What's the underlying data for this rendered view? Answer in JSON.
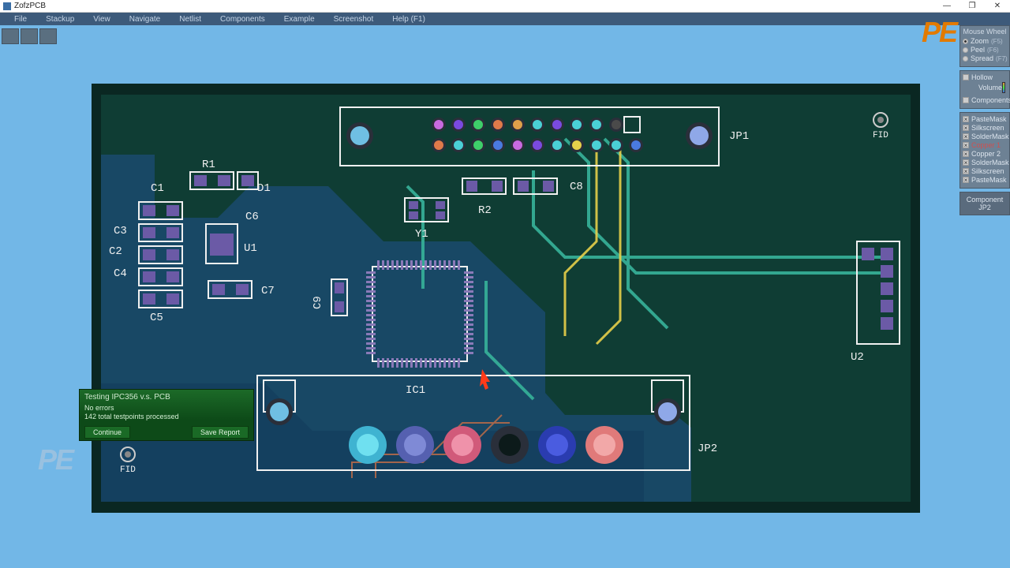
{
  "app": {
    "title": "ZofzPCB"
  },
  "window_controls": {
    "min": "—",
    "max": "❐",
    "close": "✕"
  },
  "menu": {
    "items": [
      "File",
      "Stackup",
      "View",
      "Navigate",
      "Netlist",
      "Components",
      "Example",
      "Screenshot",
      "Help (F1)"
    ]
  },
  "watermark": {
    "top": "PE",
    "bottom": "PE"
  },
  "side": {
    "wheel_title": "Mouse Wheel",
    "wheel_opts": [
      {
        "label": "Zoom",
        "kb": "(F5)",
        "selected": true
      },
      {
        "label": "Peel",
        "kb": "(F6)",
        "selected": false
      },
      {
        "label": "Spread",
        "kb": "(F7)",
        "selected": false
      }
    ],
    "hollow": "Hollow",
    "volume": "Volume",
    "components": "Components",
    "layers": [
      {
        "label": "PasteMask",
        "cls": ""
      },
      {
        "label": "Silkscreen",
        "cls": ""
      },
      {
        "label": "SolderMask",
        "cls": ""
      },
      {
        "label": "Copper 1",
        "cls": "copper1"
      },
      {
        "label": "Copper 2",
        "cls": ""
      },
      {
        "label": "SolderMask",
        "cls": ""
      },
      {
        "label": "Silkscreen",
        "cls": ""
      },
      {
        "label": "PasteMask",
        "cls": ""
      }
    ],
    "component_panel": {
      "title": "Component",
      "value": "JP2"
    }
  },
  "dialog": {
    "title": "Testing IPC356 v.s. PCB",
    "line1": "No errors",
    "line2": "142 total testpoints processed",
    "btn_continue": "Continue",
    "btn_save": "Save Report"
  },
  "board": {
    "designators": {
      "R1": "R1",
      "D1": "D1",
      "C1": "C1",
      "C2": "C2",
      "C3": "C3",
      "C4": "C4",
      "C5": "C5",
      "C6": "C6",
      "C7": "C7",
      "C8": "C8",
      "C9": "C9",
      "U1": "U1",
      "U2": "U2",
      "R2": "R2",
      "Y1": "Y1",
      "IC1": "IC1",
      "JP1": "JP1",
      "JP2": "JP2",
      "FID_tl": "FID",
      "FID_bl": "FID"
    }
  }
}
